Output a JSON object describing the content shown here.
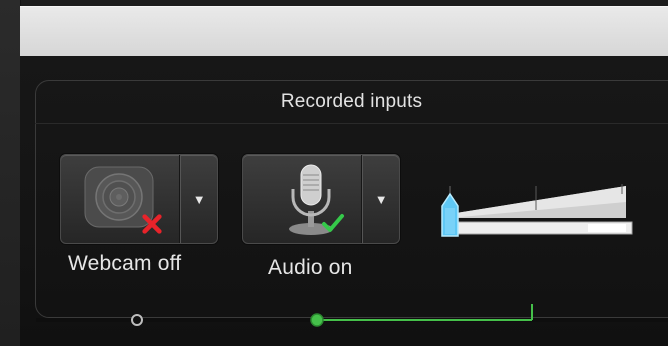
{
  "panel": {
    "title": "Recorded inputs"
  },
  "webcam": {
    "label": "Webcam off",
    "state": "off",
    "icon": "webcam-icon",
    "status_icon": "red-x-icon",
    "status_color": "#e8232a"
  },
  "audio": {
    "label": "Audio on",
    "state": "on",
    "icon": "microphone-icon",
    "status_icon": "green-check-icon",
    "status_color": "#35c94a",
    "volume_level": 0.08
  },
  "dropdown_arrow": "▼",
  "colors": {
    "slider_thumb": "#5fc8f5",
    "timeline_active": "#45c04a",
    "timeline_inactive": "#bdbdbd"
  }
}
